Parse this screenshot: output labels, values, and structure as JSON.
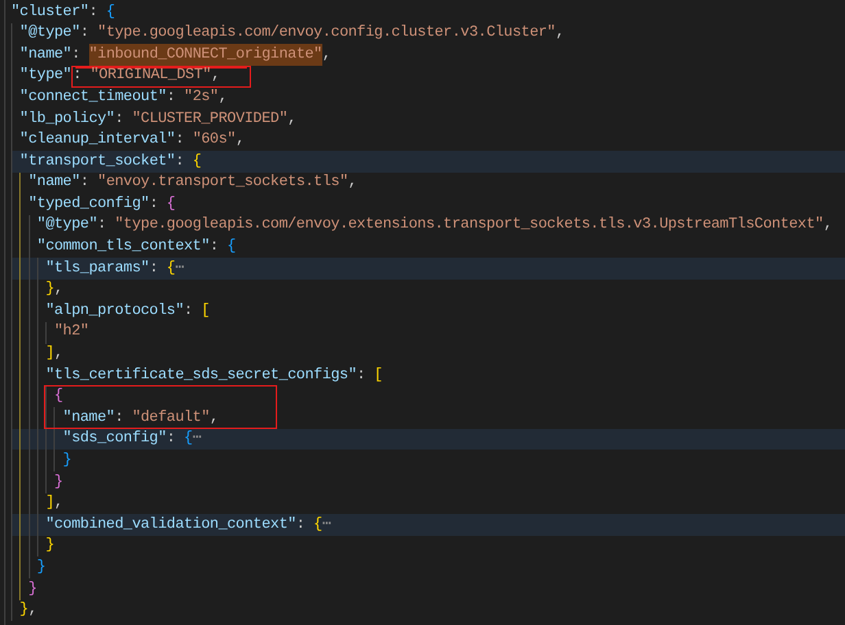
{
  "editor": {
    "lines": [
      {
        "tokens": [
          {
            "kind": "key",
            "text": "\"cluster\""
          },
          {
            "kind": "punct",
            "text": ": "
          },
          {
            "kind": "bracket",
            "text": "{",
            "color": "#179fff"
          }
        ],
        "children": [
          {
            "tokens": [
              {
                "kind": "key",
                "text": "\"@type\""
              },
              {
                "kind": "punct",
                "text": ": "
              },
              {
                "kind": "string",
                "text": "\"type.googleapis.com/envoy.config.cluster.v3.Cluster\""
              },
              {
                "kind": "punct",
                "text": ","
              }
            ]
          },
          {
            "underlined": true,
            "tokens": [
              {
                "kind": "key",
                "text": "\"name\""
              },
              {
                "kind": "punct",
                "text": ": "
              },
              {
                "kind": "string",
                "text": "\"inbound_CONNECT_originate\"",
                "selected": true
              },
              {
                "kind": "punct",
                "text": ","
              }
            ]
          },
          {
            "tokens": [
              {
                "kind": "key",
                "text": "\"type\""
              },
              {
                "kind": "punct",
                "text": ": ",
                "boxed": true
              },
              {
                "kind": "string",
                "text": "\"ORIGINAL_DST\"",
                "boxed": true
              },
              {
                "kind": "punct",
                "text": ",",
                "boxed": true
              }
            ]
          },
          {
            "tokens": [
              {
                "kind": "key",
                "text": "\"connect_timeout\""
              },
              {
                "kind": "punct",
                "text": ": "
              },
              {
                "kind": "string",
                "text": "\"2s\""
              },
              {
                "kind": "punct",
                "text": ","
              }
            ]
          },
          {
            "tokens": [
              {
                "kind": "key",
                "text": "\"lb_policy\""
              },
              {
                "kind": "punct",
                "text": ": "
              },
              {
                "kind": "string",
                "text": "\"CLUSTER_PROVIDED\""
              },
              {
                "kind": "punct",
                "text": ","
              }
            ]
          },
          {
            "tokens": [
              {
                "kind": "key",
                "text": "\"cleanup_interval\""
              },
              {
                "kind": "punct",
                "text": ": "
              },
              {
                "kind": "string",
                "text": "\"60s\""
              },
              {
                "kind": "punct",
                "text": ","
              }
            ]
          },
          {
            "highlighted": true,
            "active": true,
            "tokens": [
              {
                "kind": "key",
                "text": "\"transport_socket\""
              },
              {
                "kind": "punct",
                "text": ": "
              },
              {
                "kind": "bracket",
                "text": "{",
                "color": "#ffd700"
              }
            ],
            "children": [
              {
                "tokens": [
                  {
                    "kind": "key",
                    "text": "\"name\""
                  },
                  {
                    "kind": "punct",
                    "text": ": "
                  },
                  {
                    "kind": "string",
                    "text": "\"envoy.transport_sockets.tls\""
                  },
                  {
                    "kind": "punct",
                    "text": ","
                  }
                ]
              },
              {
                "tokens": [
                  {
                    "kind": "key",
                    "text": "\"typed_config\""
                  },
                  {
                    "kind": "punct",
                    "text": ": "
                  },
                  {
                    "kind": "bracket",
                    "text": "{",
                    "color": "#da70d6"
                  }
                ],
                "children": [
                  {
                    "tokens": [
                      {
                        "kind": "key",
                        "text": "\"@type\""
                      },
                      {
                        "kind": "punct",
                        "text": ": "
                      },
                      {
                        "kind": "string",
                        "text": "\"type.googleapis.com/envoy.extensions.transport_sockets.tls.v3.UpstreamTlsContext\""
                      },
                      {
                        "kind": "punct",
                        "text": ","
                      }
                    ]
                  },
                  {
                    "tokens": [
                      {
                        "kind": "key",
                        "text": "\"common_tls_context\""
                      },
                      {
                        "kind": "punct",
                        "text": ": "
                      },
                      {
                        "kind": "bracket",
                        "text": "{",
                        "color": "#179fff"
                      }
                    ],
                    "children": [
                      {
                        "highlighted": true,
                        "tokens": [
                          {
                            "kind": "key",
                            "text": "\"tls_params\""
                          },
                          {
                            "kind": "punct",
                            "text": ": "
                          },
                          {
                            "kind": "bracket",
                            "text": "{",
                            "color": "#ffd700"
                          },
                          {
                            "kind": "fold",
                            "text": "⋯"
                          }
                        ]
                      },
                      {
                        "tokens": [
                          {
                            "kind": "bracket",
                            "text": "}",
                            "color": "#ffd700"
                          },
                          {
                            "kind": "punct",
                            "text": ","
                          }
                        ]
                      },
                      {
                        "tokens": [
                          {
                            "kind": "key",
                            "text": "\"alpn_protocols\""
                          },
                          {
                            "kind": "punct",
                            "text": ": "
                          },
                          {
                            "kind": "bracket",
                            "text": "[",
                            "color": "#ffd700"
                          }
                        ],
                        "children": [
                          {
                            "tokens": [
                              {
                                "kind": "string",
                                "text": "\"h2\""
                              }
                            ]
                          }
                        ]
                      },
                      {
                        "tokens": [
                          {
                            "kind": "bracket",
                            "text": "]",
                            "color": "#ffd700"
                          },
                          {
                            "kind": "punct",
                            "text": ","
                          }
                        ]
                      },
                      {
                        "tokens": [
                          {
                            "kind": "key",
                            "text": "\"tls_certificate_sds_secret_configs\""
                          },
                          {
                            "kind": "punct",
                            "text": ": "
                          },
                          {
                            "kind": "bracket",
                            "text": "[",
                            "color": "#ffd700"
                          }
                        ],
                        "children": [
                          {
                            "boxed": true,
                            "tokens": [
                              {
                                "kind": "bracket",
                                "text": "{",
                                "color": "#da70d6"
                              }
                            ],
                            "children": [
                              {
                                "tokens": [
                                  {
                                    "kind": "key",
                                    "text": "\"name\""
                                  },
                                  {
                                    "kind": "punct",
                                    "text": ": "
                                  },
                                  {
                                    "kind": "string",
                                    "text": "\"default\""
                                  },
                                  {
                                    "kind": "punct",
                                    "text": ","
                                  }
                                ]
                              },
                              {
                                "highlighted": true,
                                "tokens": [
                                  {
                                    "kind": "key",
                                    "text": "\"sds_config\""
                                  },
                                  {
                                    "kind": "punct",
                                    "text": ": "
                                  },
                                  {
                                    "kind": "bracket",
                                    "text": "{",
                                    "color": "#179fff"
                                  },
                                  {
                                    "kind": "fold",
                                    "text": "⋯"
                                  }
                                ]
                              },
                              {
                                "tokens": [
                                  {
                                    "kind": "bracket",
                                    "text": "}",
                                    "color": "#179fff"
                                  }
                                ]
                              }
                            ]
                          },
                          {
                            "tokens": [
                              {
                                "kind": "bracket",
                                "text": "}",
                                "color": "#da70d6"
                              }
                            ]
                          }
                        ]
                      },
                      {
                        "tokens": [
                          {
                            "kind": "bracket",
                            "text": "]",
                            "color": "#ffd700"
                          },
                          {
                            "kind": "punct",
                            "text": ","
                          }
                        ]
                      },
                      {
                        "highlighted": true,
                        "tokens": [
                          {
                            "kind": "key",
                            "text": "\"combined_validation_context\""
                          },
                          {
                            "kind": "punct",
                            "text": ": "
                          },
                          {
                            "kind": "bracket",
                            "text": "{",
                            "color": "#ffd700"
                          },
                          {
                            "kind": "fold",
                            "text": "⋯"
                          }
                        ]
                      },
                      {
                        "tokens": [
                          {
                            "kind": "bracket",
                            "text": "}",
                            "color": "#ffd700"
                          }
                        ]
                      }
                    ]
                  },
                  {
                    "tokens": [
                      {
                        "kind": "bracket",
                        "text": "}",
                        "color": "#179fff"
                      }
                    ]
                  }
                ]
              },
              {
                "tokens": [
                  {
                    "kind": "bracket",
                    "text": "}",
                    "color": "#da70d6"
                  }
                ]
              }
            ]
          },
          {
            "tokens": [
              {
                "kind": "bracket",
                "text": "}",
                "color": "#ffd700"
              },
              {
                "kind": "punct",
                "text": ","
              }
            ]
          }
        ]
      }
    ]
  }
}
